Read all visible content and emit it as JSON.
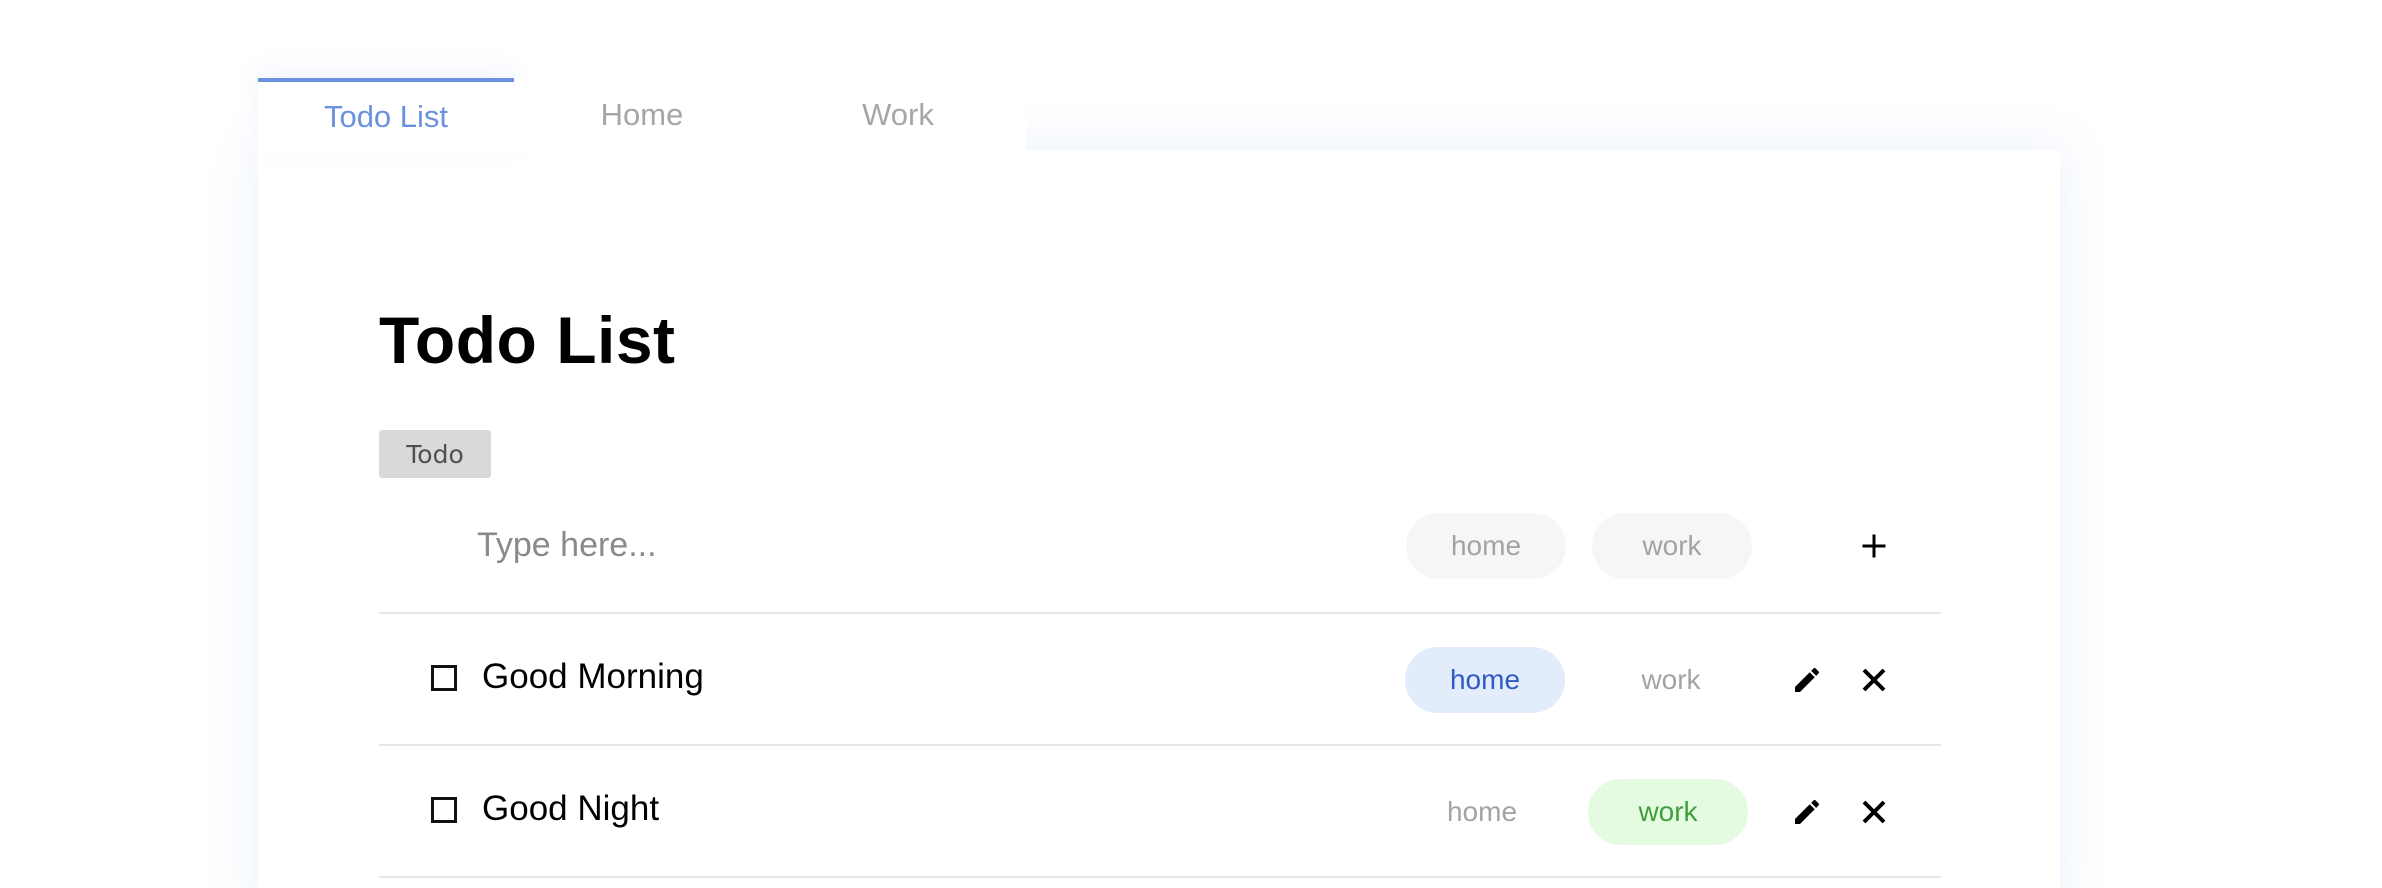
{
  "tabs": [
    {
      "label": "Todo List",
      "active": true
    },
    {
      "label": "Home",
      "active": false
    },
    {
      "label": "Work",
      "active": false
    }
  ],
  "page": {
    "title": "Todo List",
    "badge": "Todo"
  },
  "new_item": {
    "placeholder": "Type here...",
    "value": "",
    "tags": [
      "home",
      "work"
    ],
    "add_icon": "plus-icon"
  },
  "items": [
    {
      "text": "Good Morning",
      "checked": false,
      "tags": [
        "home",
        "work"
      ],
      "active_tag": "home",
      "edit_icon": "pencil-icon",
      "delete_icon": "close-icon"
    },
    {
      "text": "Good Night",
      "checked": false,
      "tags": [
        "home",
        "work"
      ],
      "active_tag": "work",
      "edit_icon": "pencil-icon",
      "delete_icon": "close-icon"
    }
  ],
  "colors": {
    "accent": "#6b93dd",
    "home_tag_bg": "#e3ecfb",
    "home_tag_text": "#2e5bc4",
    "work_tag_bg": "#e4fbe2",
    "work_tag_text": "#3f9e3b",
    "inactive_text": "#a3a3a3",
    "divider": "#e6e6e6"
  }
}
